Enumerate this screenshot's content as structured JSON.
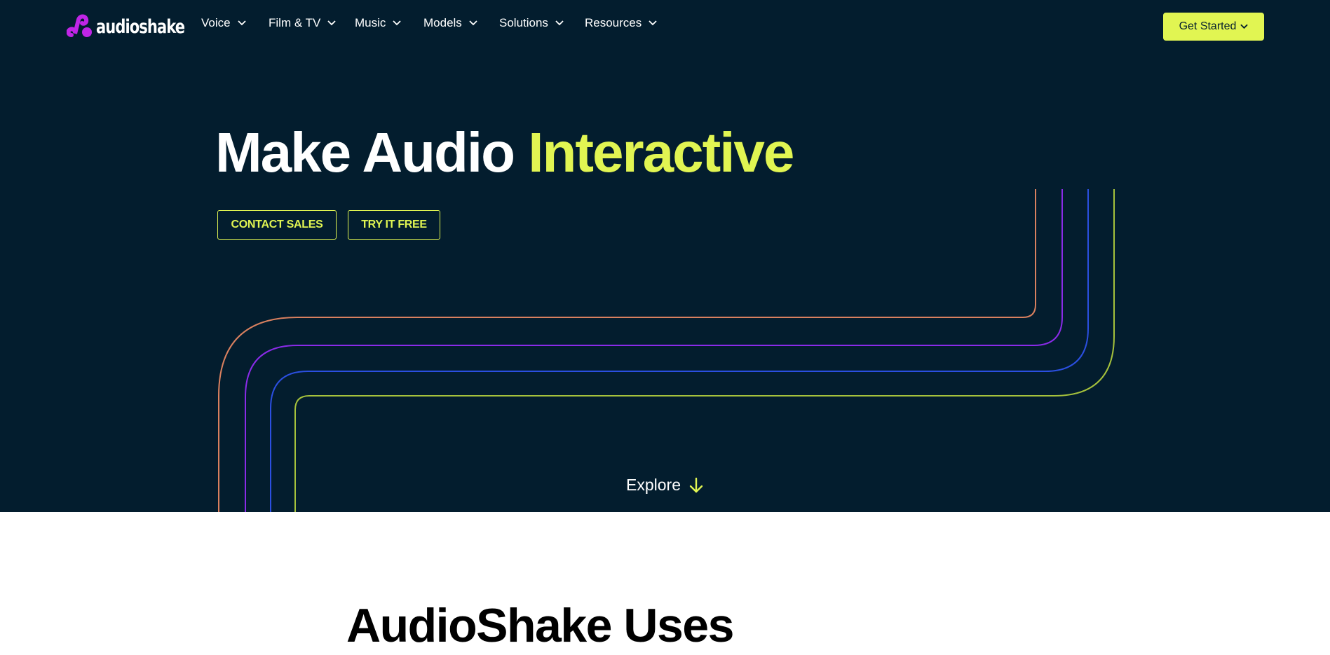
{
  "brand": {
    "name": "audioshake",
    "logo_color": "#c025e6"
  },
  "nav": {
    "items": [
      {
        "label": "Voice"
      },
      {
        "label": "Film & TV"
      },
      {
        "label": "Music"
      },
      {
        "label": "Models"
      },
      {
        "label": "Solutions"
      },
      {
        "label": "Resources"
      }
    ],
    "cta_label": "Get Started"
  },
  "hero": {
    "headline_part1": "Make Audio",
    "headline_accent": "Interactive",
    "buttons": {
      "contact": "CONTACT SALES",
      "try": "TRY IT FREE"
    },
    "explore_label": "Explore"
  },
  "section": {
    "title": "AudioShake Uses"
  },
  "colors": {
    "hero_bg": "#031d2e",
    "accent": "#e1f552",
    "line_orange": "#d9805f",
    "line_purple": "#8a2be8",
    "line_blue": "#2b4fe0",
    "line_green": "#a6c23c"
  },
  "icons": [
    "audioshake-logo-icon",
    "chevron-down-icon",
    "arrow-down-icon"
  ]
}
